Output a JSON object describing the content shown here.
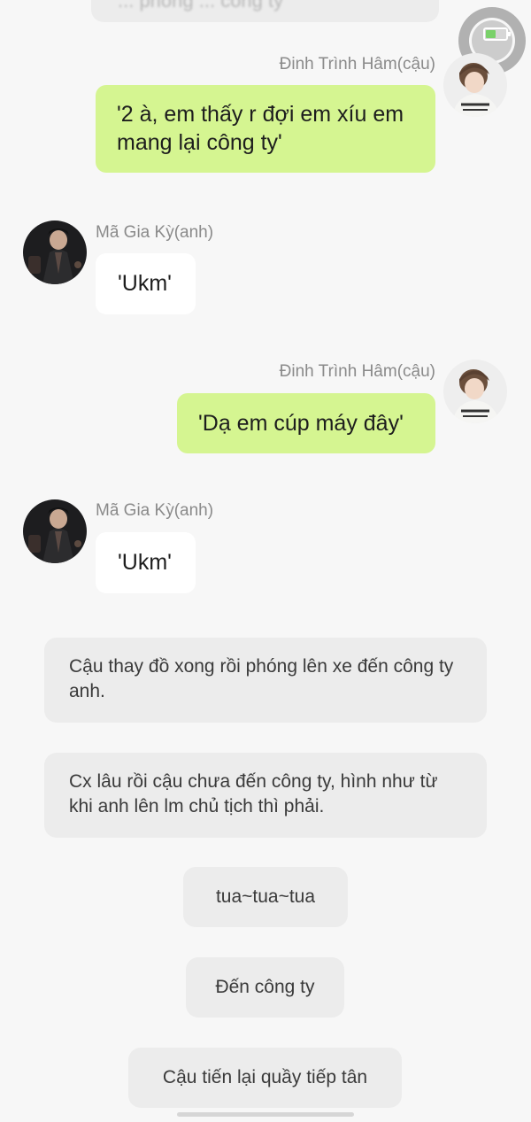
{
  "header": {
    "partial_message_text": "... phòng ... công ty"
  },
  "participants": {
    "cau": {
      "name": "Đinh Trình Hâm(cậu)",
      "bubble_color": "#d5f591"
    },
    "anh": {
      "name": "Mã Gia Kỳ(anh)",
      "bubble_color": "#ffffff"
    }
  },
  "messages": [
    {
      "sender": "Đinh Trình Hâm(cậu)",
      "text": "'2 à, em thấy r đợi em xíu em mang lại công ty'"
    },
    {
      "sender": "Mã Gia Kỳ(anh)",
      "text": "'Ukm'"
    },
    {
      "sender": "Đinh Trình Hâm(cậu)",
      "text": "'Dạ em cúp máy đây'"
    },
    {
      "sender": "Mã Gia Kỳ(anh)",
      "text": "'Ukm'"
    }
  ],
  "narrations": [
    "Cậu thay đồ xong rồi phóng lên xe đến công ty anh.",
    "Cx lâu rồi cậu chưa đến công ty, hình như từ khi anh lên lm chủ tịch thì phải.",
    "tua~tua~tua",
    "Đến công ty",
    "Cậu tiến lại quầy tiếp tân"
  ],
  "icons": {
    "screen_record": "screen-record-icon",
    "battery": "battery-icon"
  }
}
